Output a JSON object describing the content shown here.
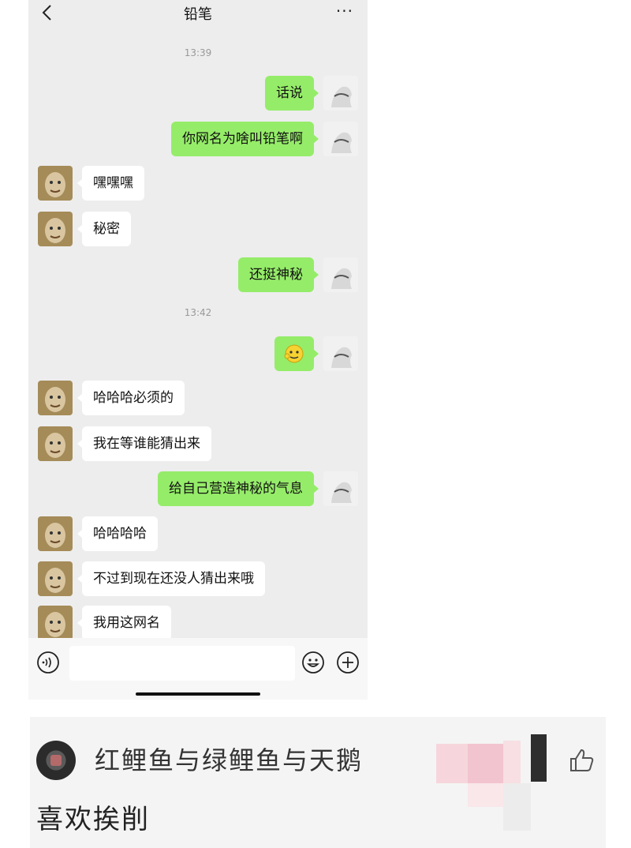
{
  "chat": {
    "title": "铅笔",
    "more_label": "···",
    "messages": [
      {
        "kind": "time",
        "text": "13:39"
      },
      {
        "kind": "me",
        "text": "话说"
      },
      {
        "kind": "me",
        "text": "你网名为啥叫铅笔啊"
      },
      {
        "kind": "other",
        "text": "嘿嘿嘿"
      },
      {
        "kind": "other",
        "text": "秘密"
      },
      {
        "kind": "me",
        "text": "还挺神秘"
      },
      {
        "kind": "time",
        "text": "13:42"
      },
      {
        "kind": "me",
        "sticker": "face-sticker"
      },
      {
        "kind": "other",
        "text": "哈哈哈必须的"
      },
      {
        "kind": "other",
        "text": "我在等谁能猜出来"
      },
      {
        "kind": "me",
        "text": "给自己营造神秘的气息"
      },
      {
        "kind": "other",
        "text": "哈哈哈哈"
      },
      {
        "kind": "other",
        "text": "不过到现在还没人猜出来哦"
      },
      {
        "kind": "other",
        "text": "我用这网名"
      }
    ],
    "input": {
      "value": "",
      "placeholder": ""
    },
    "icons": [
      "back-icon",
      "more-icon",
      "voice-icon",
      "emoji-icon",
      "plus-icon"
    ]
  },
  "comment": {
    "username": "红鲤鱼与绿鲤鱼与天鹅",
    "text": "喜欢挨削",
    "icons": [
      "avatar",
      "like-icon"
    ]
  },
  "colors": {
    "chat_background": "#ededed",
    "my_bubble": "#95ec69",
    "their_bubble": "#ffffff",
    "comment_background": "#f4f4f4"
  }
}
